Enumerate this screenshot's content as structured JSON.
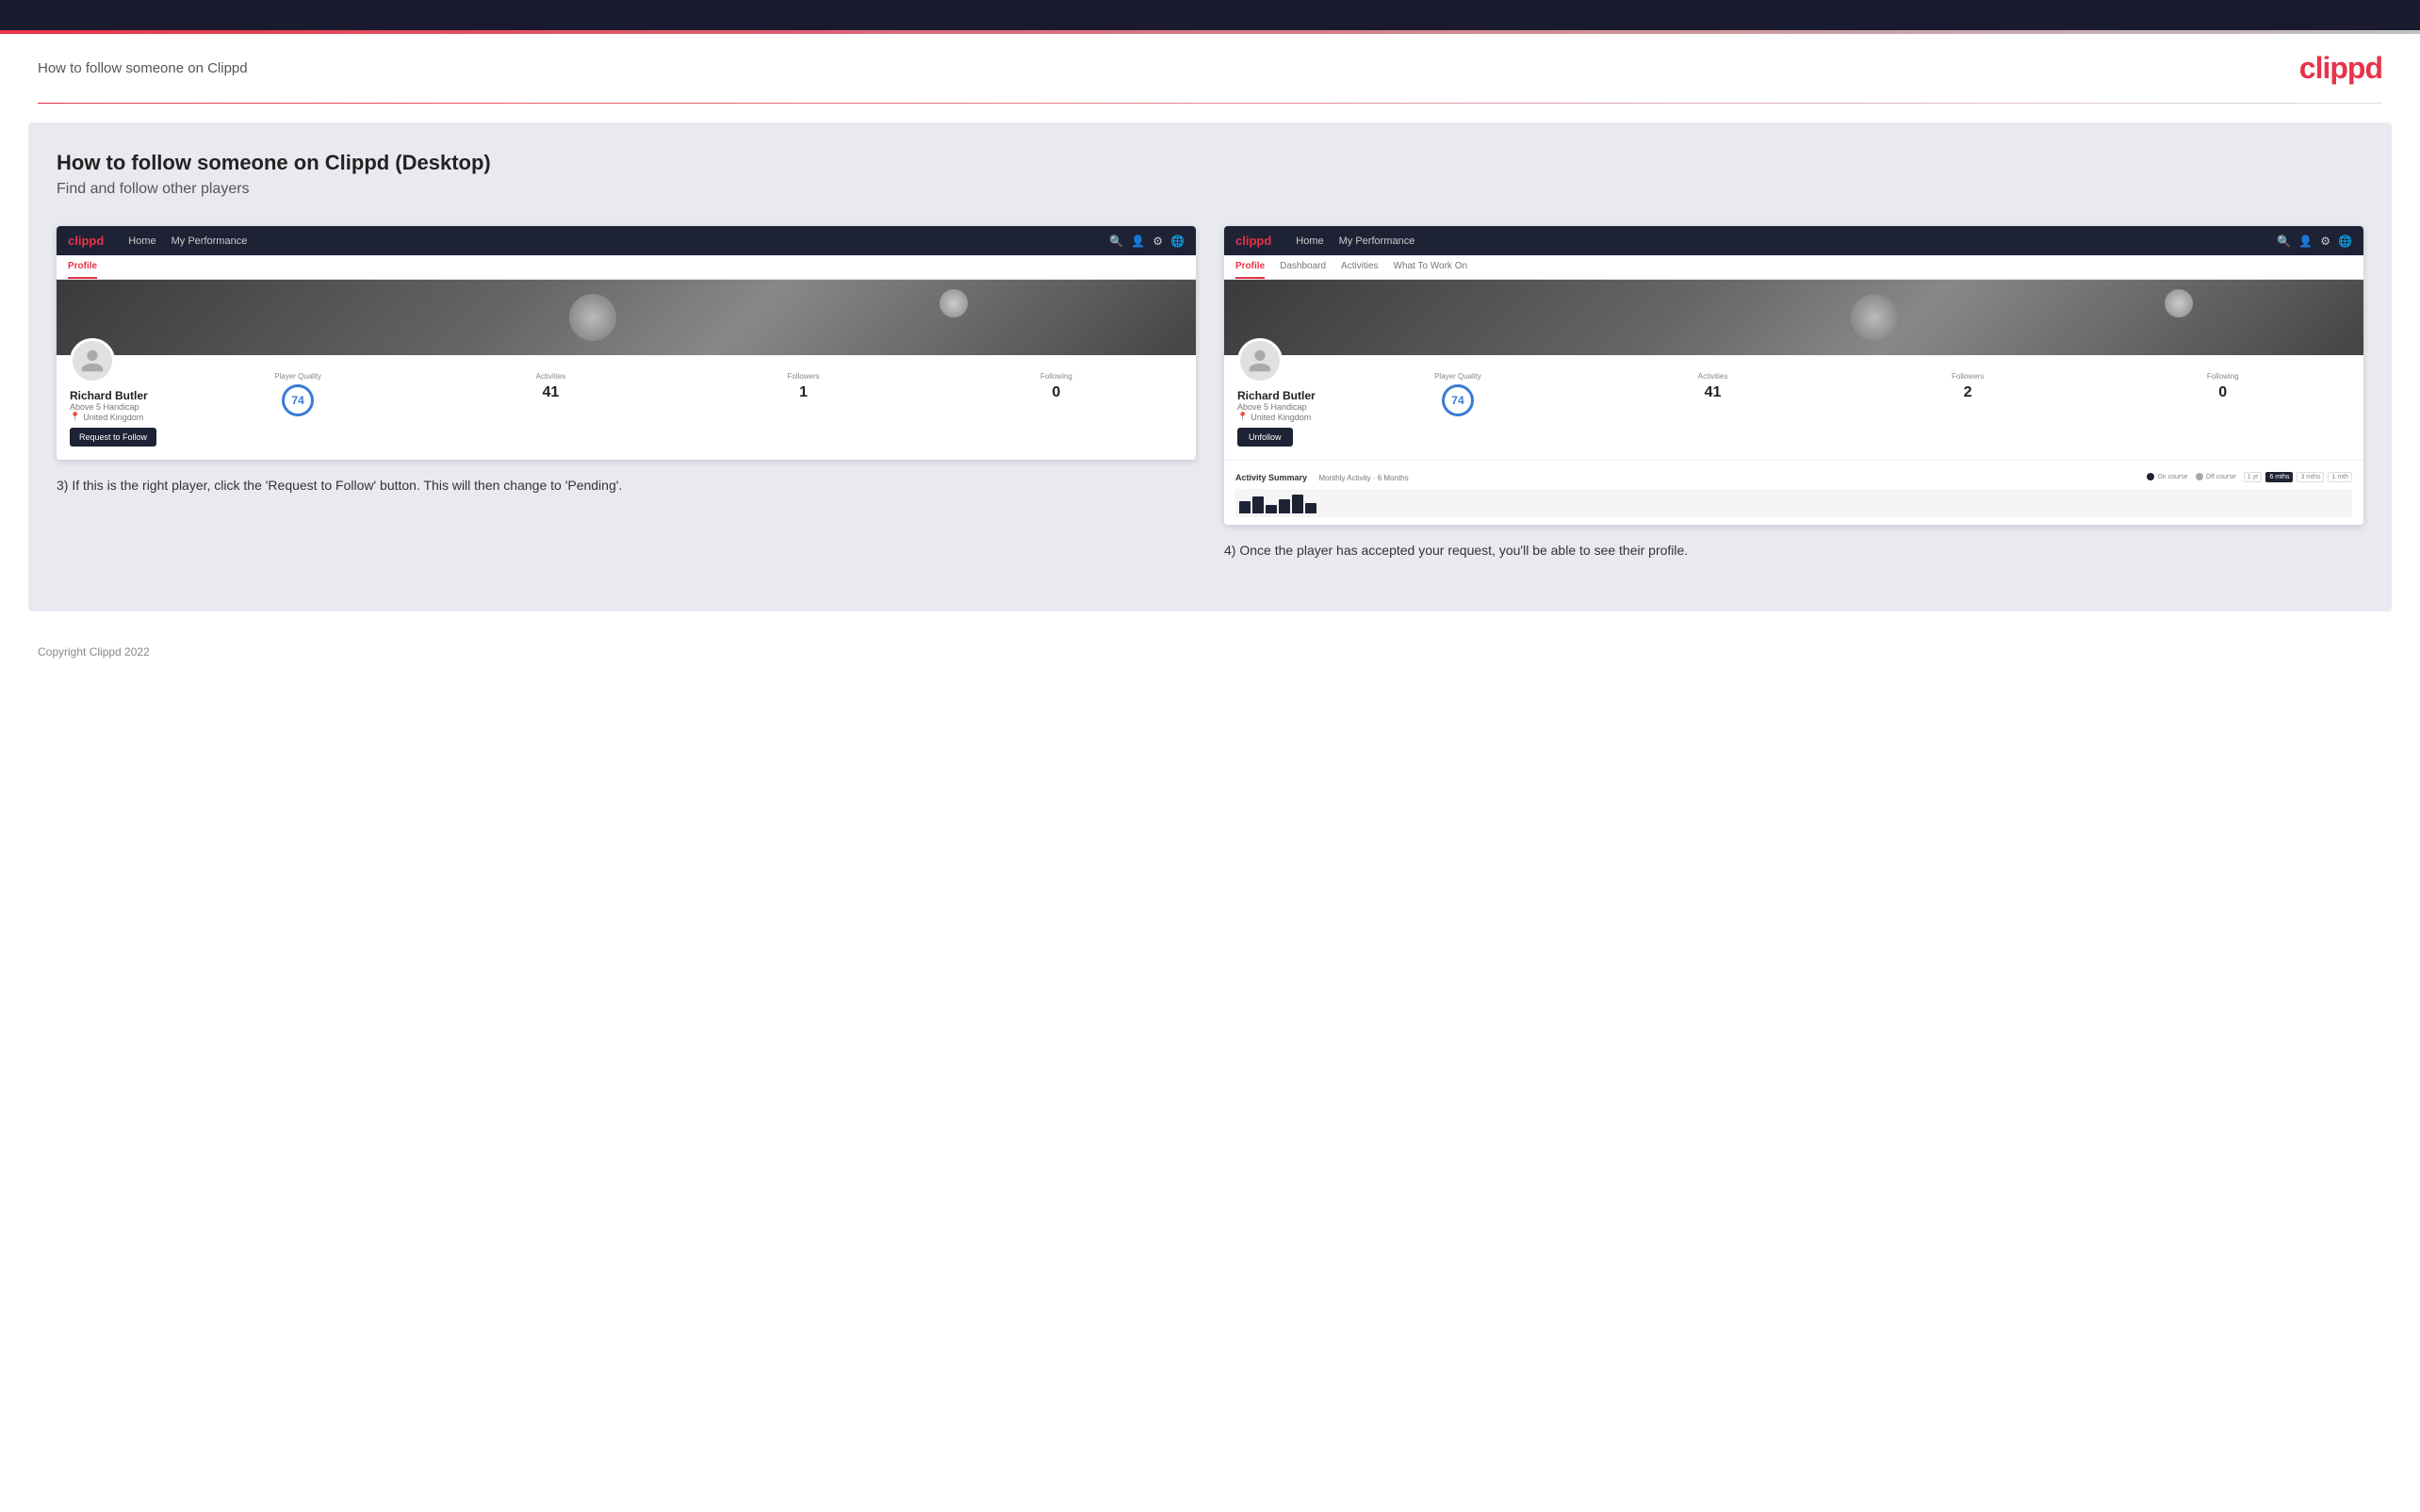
{
  "topbar": {},
  "header": {
    "title": "How to follow someone on Clippd",
    "logo": "clippd"
  },
  "main": {
    "heading": "How to follow someone on Clippd (Desktop)",
    "subheading": "Find and follow other players",
    "screenshot1": {
      "nav": {
        "logo": "clippd",
        "items": [
          "Home",
          "My Performance"
        ]
      },
      "tab": "Profile",
      "player": {
        "name": "Richard Butler",
        "handicap": "Above 5 Handicap",
        "location": "United Kingdom",
        "quality": "74",
        "quality_label": "Player Quality",
        "activities": "41",
        "activities_label": "Activities",
        "followers": "1",
        "followers_label": "Followers",
        "following": "0",
        "following_label": "Following",
        "button": "Request to Follow"
      }
    },
    "screenshot2": {
      "nav": {
        "logo": "clippd",
        "items": [
          "Home",
          "My Performance"
        ]
      },
      "tabs": [
        "Profile",
        "Dashboard",
        "Activities",
        "What To Work On"
      ],
      "player": {
        "name": "Richard Butler",
        "handicap": "Above 5 Handicap",
        "location": "United Kingdom",
        "quality": "74",
        "quality_label": "Player Quality",
        "activities": "41",
        "activities_label": "Activities",
        "followers": "2",
        "followers_label": "Followers",
        "following": "0",
        "following_label": "Following",
        "button": "Unfollow"
      },
      "activity": {
        "title": "Activity Summary",
        "subtitle": "Monthly Activity · 6 Months",
        "filters": [
          "1 yr",
          "6 mths",
          "3 mths",
          "1 mth"
        ],
        "active_filter": "6 mths",
        "legend": [
          "On course",
          "Off course"
        ]
      }
    },
    "description3": "3) If this is the right player, click the 'Request to Follow' button. This will then change to 'Pending'.",
    "description4": "4) Once the player has accepted your request, you'll be able to see their profile."
  },
  "footer": {
    "copyright": "Copyright Clippd 2022"
  }
}
